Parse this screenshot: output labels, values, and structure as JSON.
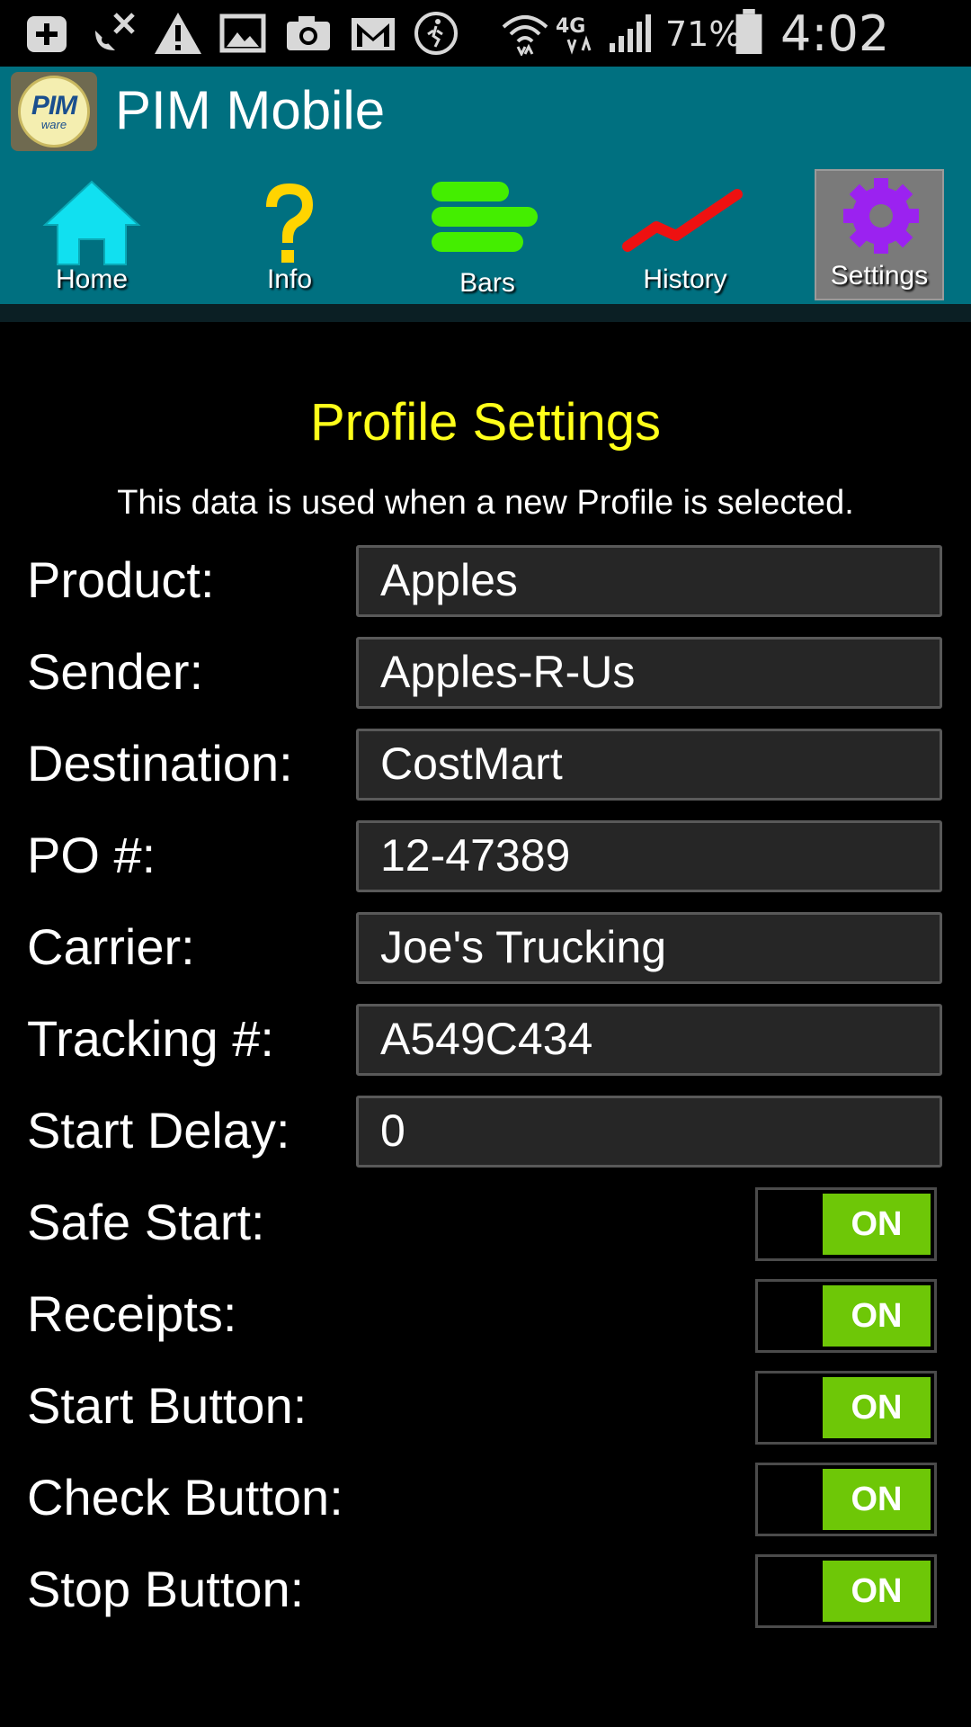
{
  "status_bar": {
    "battery_percent": "71%",
    "time": "4:02 PM",
    "network": "4G",
    "icons": [
      "add-icon",
      "satellite-off-icon",
      "warning-icon",
      "image-icon",
      "camera-icon",
      "gmail-icon",
      "running-icon",
      "wifi-icon",
      "4g-lte-icon",
      "signal-icon",
      "battery-icon"
    ]
  },
  "app": {
    "title": "PIM Mobile",
    "logo_text": "PIM",
    "logo_subtext": "ware"
  },
  "nav": {
    "items": [
      {
        "label": "Home",
        "icon": "home-icon",
        "color": "#11e0f0"
      },
      {
        "label": "Info",
        "icon": "question-icon",
        "color": "#ffd400"
      },
      {
        "label": "Bars",
        "icon": "bars-icon",
        "color": "#44ee00"
      },
      {
        "label": "History",
        "icon": "history-line-icon",
        "color": "#ee1111"
      },
      {
        "label": "Settings",
        "icon": "gear-icon",
        "color": "#9b22f0"
      }
    ],
    "active": "Settings"
  },
  "page": {
    "title": "Profile Settings",
    "subtitle": "This data is used when a new Profile is selected.",
    "fields": [
      {
        "label": "Product:",
        "value": "Apples"
      },
      {
        "label": "Sender:",
        "value": "Apples-R-Us"
      },
      {
        "label": "Destination:",
        "value": "CostMart"
      },
      {
        "label": "PO #:",
        "value": "12-47389"
      },
      {
        "label": "Carrier:",
        "value": "Joe's Trucking"
      },
      {
        "label": "Tracking #:",
        "value": "A549C434"
      },
      {
        "label": "Start Delay:",
        "value": "0"
      }
    ],
    "toggles": [
      {
        "label": "Safe Start:",
        "state": "ON"
      },
      {
        "label": "Receipts:",
        "state": "ON"
      },
      {
        "label": "Start Button:",
        "state": "ON"
      },
      {
        "label": "Check Button:",
        "state": "ON"
      },
      {
        "label": "Stop Button:",
        "state": "ON"
      }
    ]
  },
  "colors": {
    "app_bar": "#007080",
    "title_yellow": "#ffff1a",
    "toggle_on": "#6ec707"
  }
}
